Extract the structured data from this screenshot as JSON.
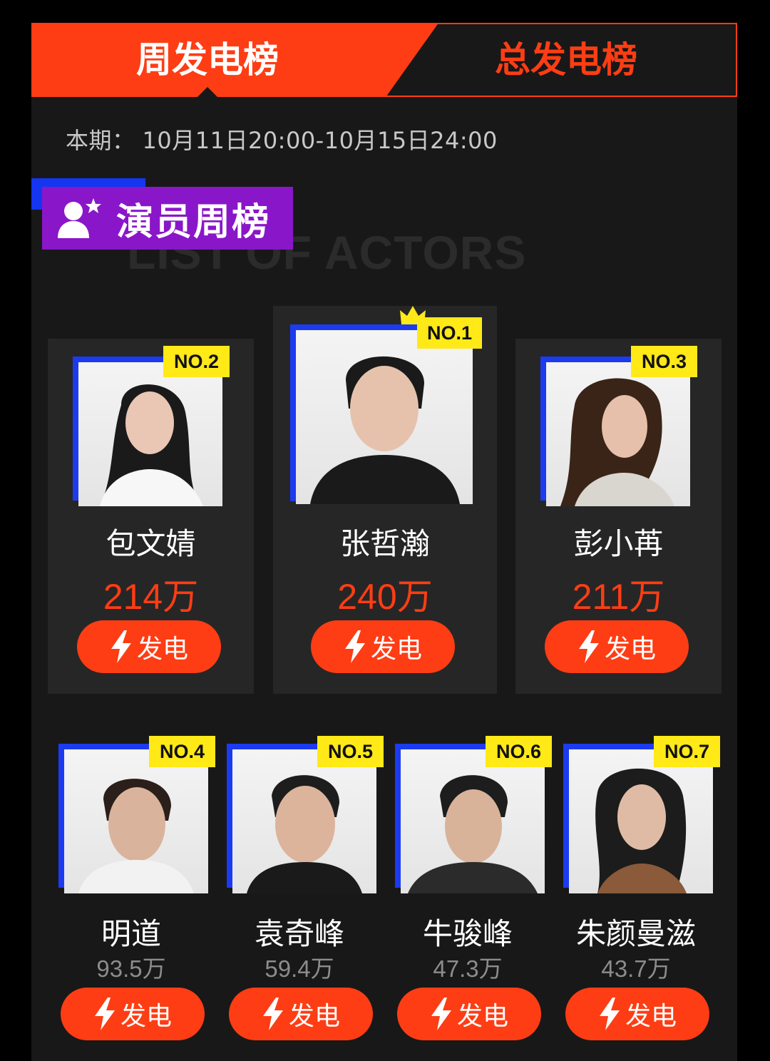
{
  "tabs": {
    "weekly": "周发电榜",
    "total": "总发电榜"
  },
  "period": {
    "label": "本期：",
    "range": "10月11日20:00-10月15日24:00"
  },
  "section": {
    "title": "演员周榜",
    "watermark": "LIST OF ACTORS"
  },
  "button_label": "发电",
  "top3": [
    {
      "rank": "NO.2",
      "name": "包文婧",
      "votes": "214万"
    },
    {
      "rank": "NO.1",
      "name": "张哲瀚",
      "votes": "240万"
    },
    {
      "rank": "NO.3",
      "name": "彭小苒",
      "votes": "211万"
    }
  ],
  "rest": [
    {
      "rank": "NO.4",
      "name": "明道",
      "votes": "93.5万"
    },
    {
      "rank": "NO.5",
      "name": "袁奇峰",
      "votes": "59.4万"
    },
    {
      "rank": "NO.6",
      "name": "牛骏峰",
      "votes": "47.3万"
    },
    {
      "rank": "NO.7",
      "name": "朱颜曼滋",
      "votes": "43.7万"
    }
  ],
  "colors": {
    "accent": "#fe3d14",
    "blue": "#1c3bf0",
    "badge": "#ffe917",
    "purple": "#8a16c9"
  }
}
